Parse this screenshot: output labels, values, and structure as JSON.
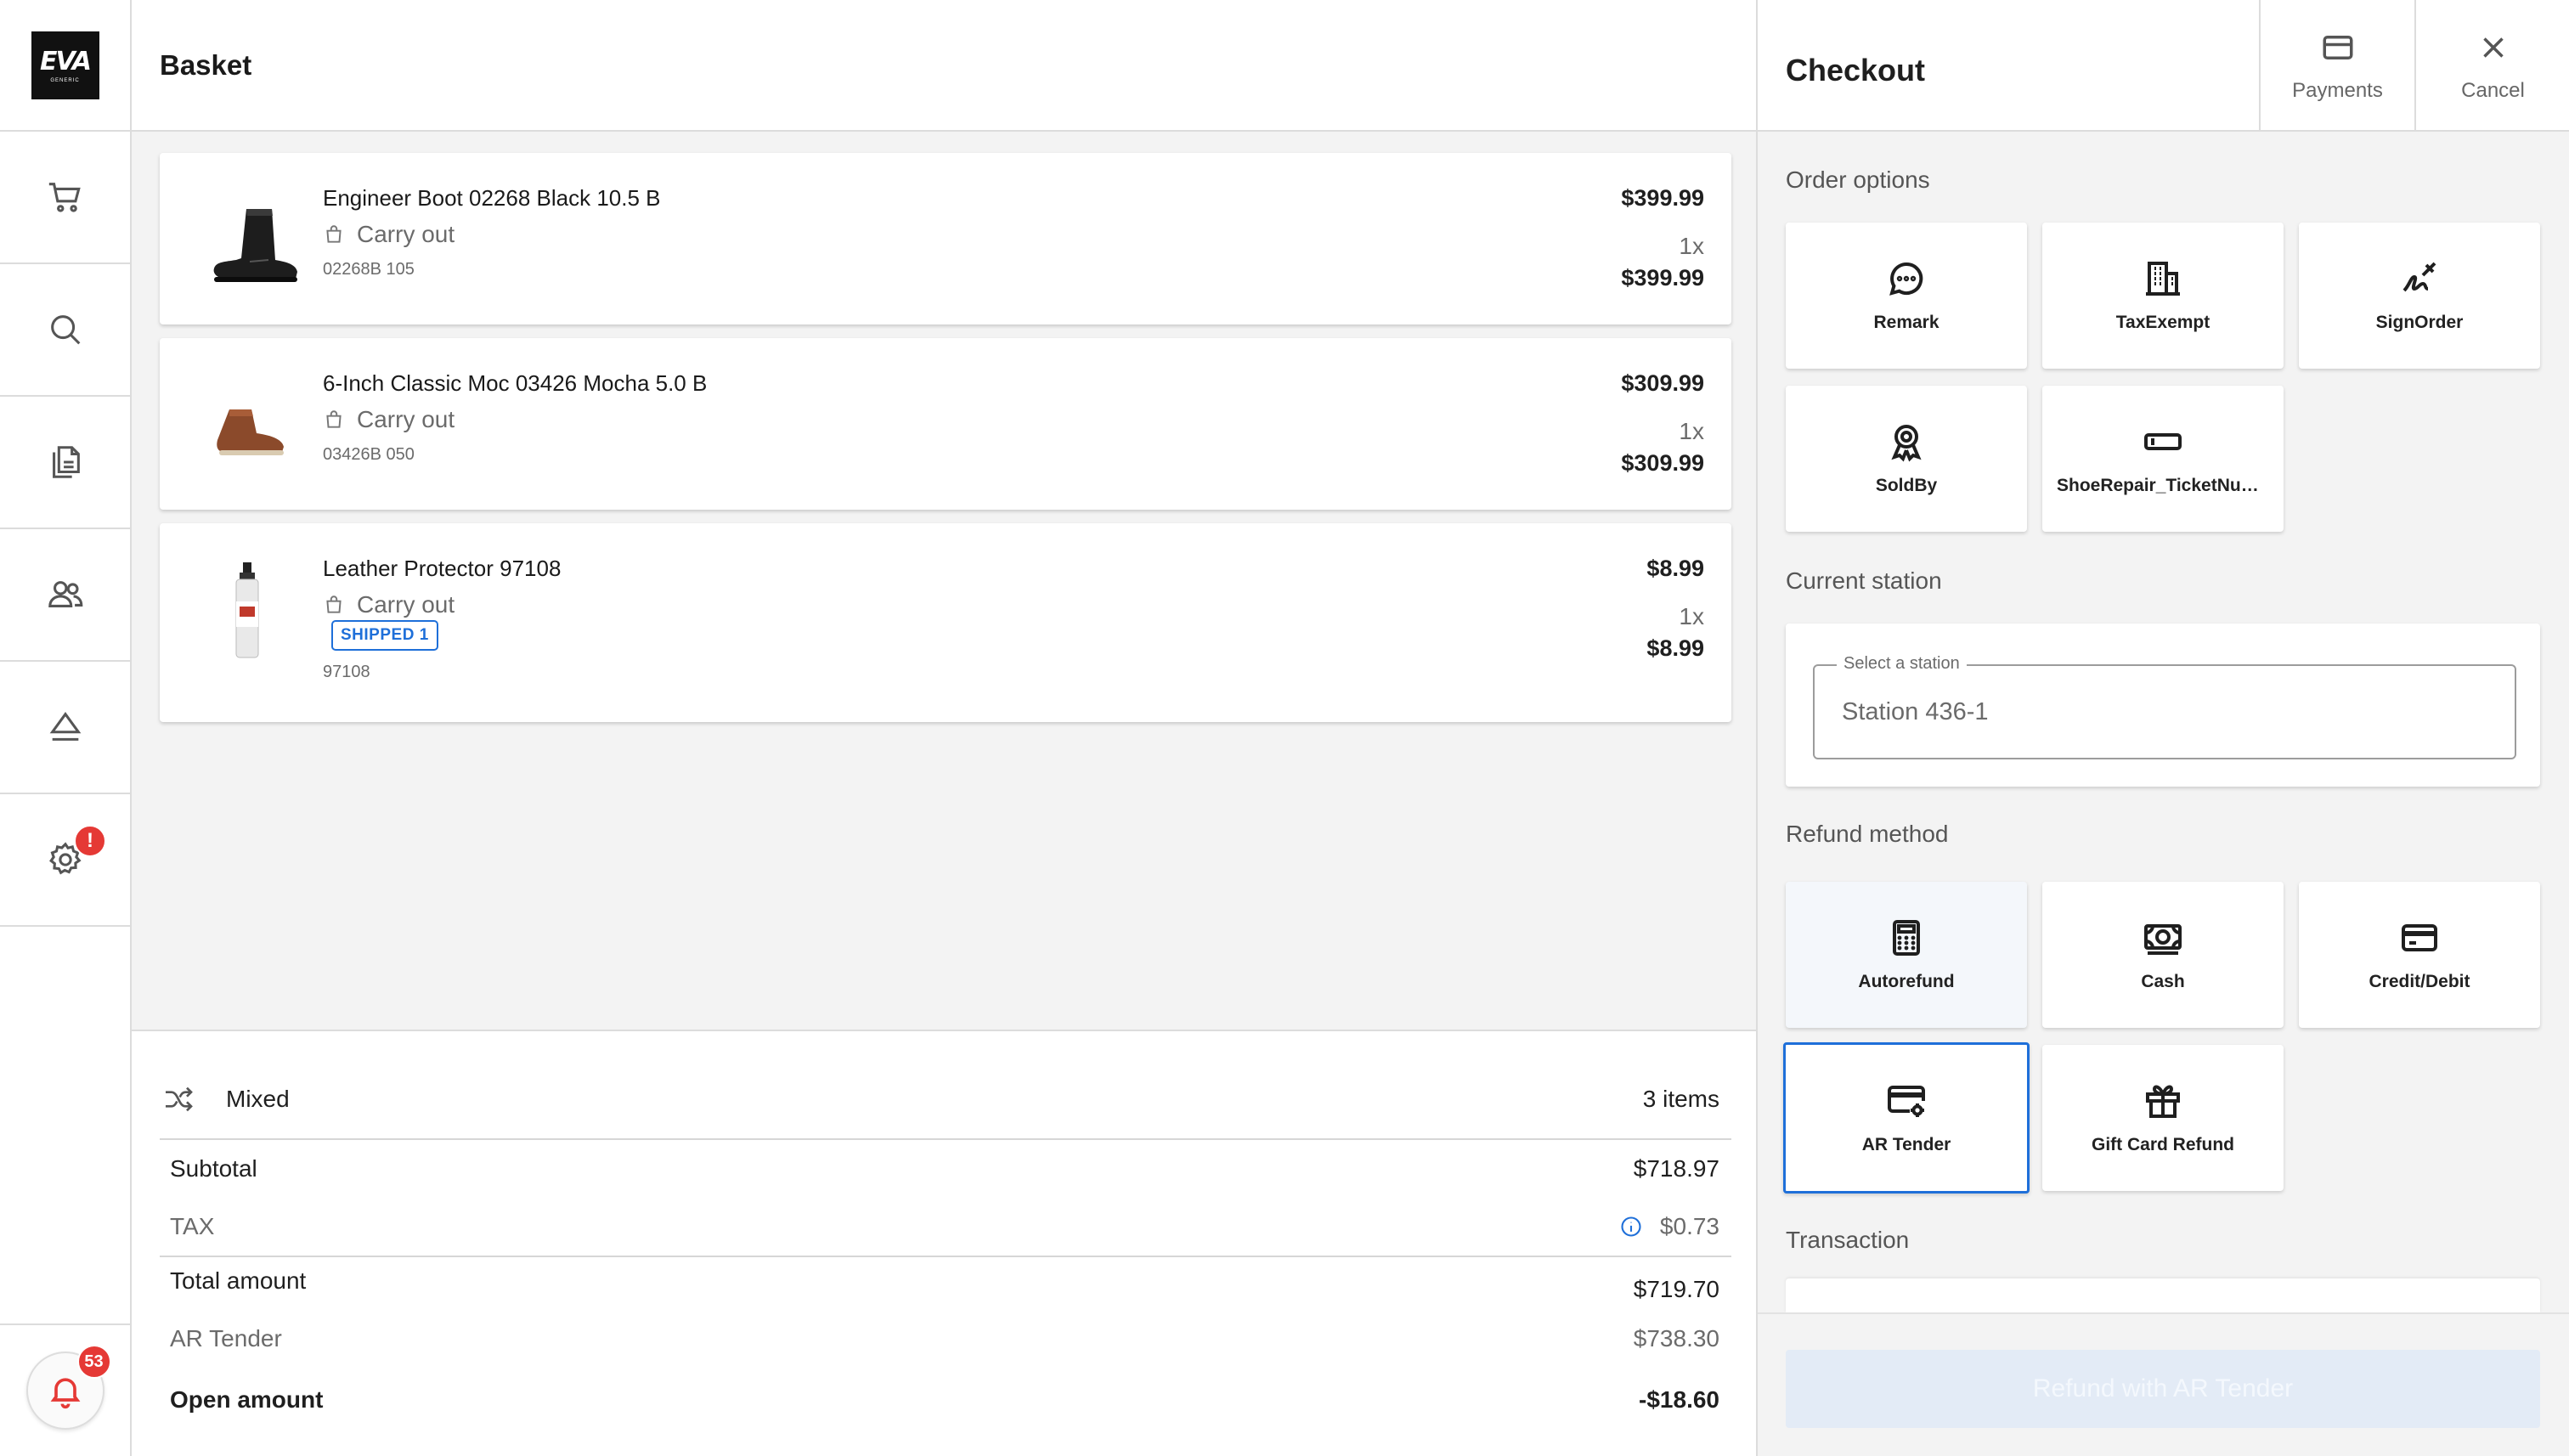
{
  "app": {
    "logo_text": "EVA",
    "logo_subtext": "GENERIC"
  },
  "rail": {
    "items": [
      {
        "icon": "cart-icon",
        "name": "rail-basket"
      },
      {
        "icon": "search-icon",
        "name": "rail-search"
      },
      {
        "icon": "documents-icon",
        "name": "rail-orders"
      },
      {
        "icon": "users-icon",
        "name": "rail-customers"
      },
      {
        "icon": "eject-icon",
        "name": "rail-eject"
      },
      {
        "icon": "gear-icon",
        "name": "rail-settings",
        "badge": "!"
      }
    ],
    "notifications": {
      "icon": "bell-icon",
      "count": "53"
    }
  },
  "basket": {
    "title": "Basket",
    "lines": [
      {
        "name": "Engineer Boot 02268 Black 10.5 B",
        "fulfillment": "Carry out",
        "sku": "02268B 105",
        "unit_price": "$399.99",
        "qty": "1x",
        "total": "$399.99",
        "image": "black-boot"
      },
      {
        "name": "6-Inch Classic Moc 03426 Mocha 5.0 B",
        "fulfillment": "Carry out",
        "sku": "03426B 050",
        "unit_price": "$309.99",
        "qty": "1x",
        "total": "$309.99",
        "image": "brown-boot"
      },
      {
        "name": "Leather Protector 97108",
        "fulfillment": "Carry out",
        "badge": "SHIPPED 1",
        "sku": "97108",
        "unit_price": "$8.99",
        "qty": "1x",
        "total": "$8.99",
        "image": "spray-bottle"
      }
    ],
    "summary": {
      "fulfillment_mode": "Mixed",
      "item_count": "3 items",
      "subtotal_label": "Subtotal",
      "subtotal": "$718.97",
      "tax_label": "TAX",
      "tax": "$0.73",
      "total_label": "Total amount",
      "total": "$719.70",
      "tender_label": "AR Tender",
      "tender": "$738.30",
      "open_label": "Open amount",
      "open": "-$18.60"
    }
  },
  "checkout": {
    "title": "Checkout",
    "payments_label": "Payments",
    "cancel_label": "Cancel",
    "order_options_label": "Order options",
    "order_options": [
      {
        "label": "Remark",
        "icon": "chat-bubble-icon"
      },
      {
        "label": "TaxExempt",
        "icon": "building-icon"
      },
      {
        "label": "SignOrder",
        "icon": "signature-icon"
      },
      {
        "label": "SoldBy",
        "icon": "award-ribbon-icon"
      },
      {
        "label": "ShoeRepair_TicketNumber",
        "icon": "ticket-icon"
      }
    ],
    "station_label": "Current station",
    "station_field_label": "Select a station",
    "station_value": "Station 436-1",
    "refund_method_label": "Refund method",
    "refund_methods": [
      {
        "label": "Autorefund",
        "icon": "calculator-icon"
      },
      {
        "label": "Cash",
        "icon": "cash-icon"
      },
      {
        "label": "Credit/Debit",
        "icon": "credit-card-icon"
      },
      {
        "label": "AR Tender",
        "icon": "card-gear-icon",
        "selected": true
      },
      {
        "label": "Gift Card Refund",
        "icon": "gift-icon"
      }
    ],
    "transaction_label": "Transaction",
    "refund_button_label": "Refund with AR Tender",
    "colors": {
      "accent": "#1e6fd9",
      "alert": "#e53935",
      "disabled_button": "#e3ebf6"
    }
  }
}
